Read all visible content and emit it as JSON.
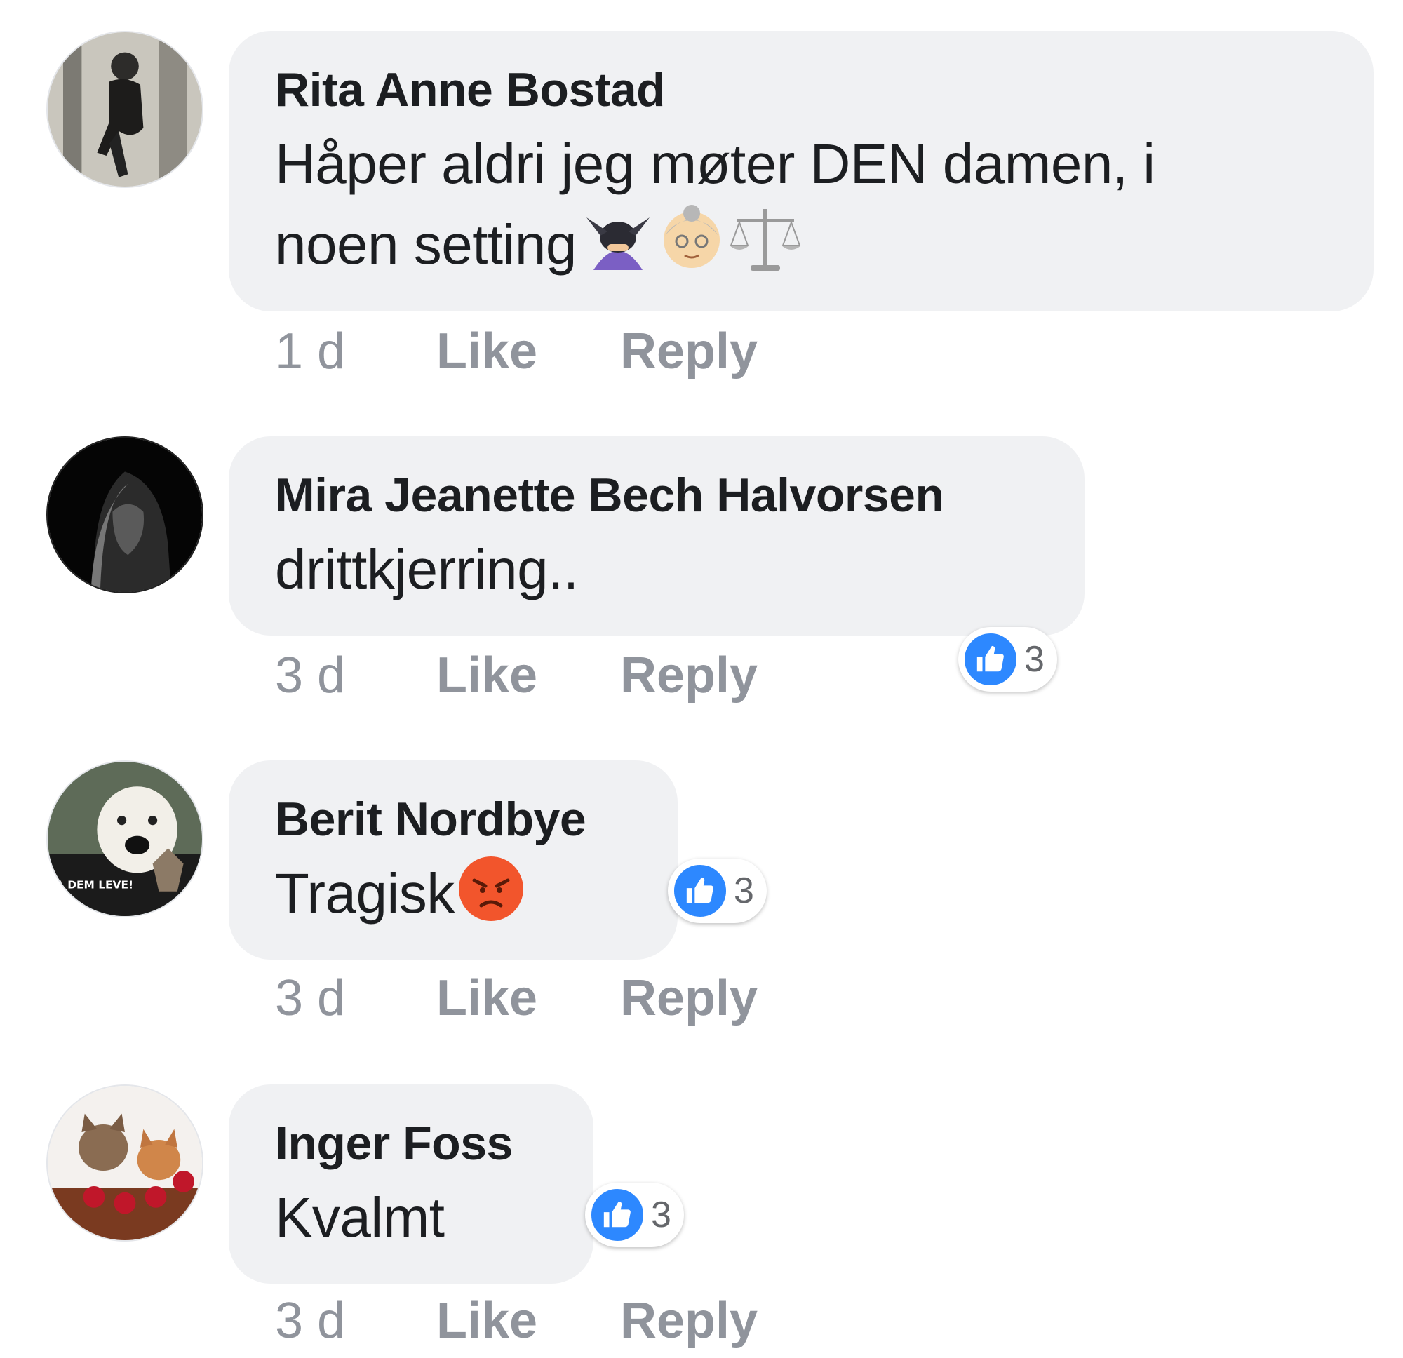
{
  "comments": [
    {
      "author": "Rita Anne Bostad",
      "text_line1": "Håper aldri jeg møter DEN damen, i",
      "text_line2": "noen setting",
      "emojis": [
        "person-bowing-emoji",
        "old-woman-emoji",
        "balance-scale-emoji"
      ],
      "time": "1 d",
      "like_label": "Like",
      "reply_label": "Reply"
    },
    {
      "author": "Mira Jeanette Bech Halvorsen",
      "text": "drittkjerring..",
      "time": "3 d",
      "like_label": "Like",
      "reply_label": "Reply",
      "reaction_count": "3"
    },
    {
      "author": "Berit Nordbye",
      "text": "Tragisk",
      "emojis": [
        "angry-face-emoji"
      ],
      "avatar_text": "LA DEM LEVE!",
      "time": "3 d",
      "like_label": "Like",
      "reply_label": "Reply",
      "reaction_count": "3"
    },
    {
      "author": "Inger Foss",
      "text": "Kvalmt",
      "time": "3 d",
      "like_label": "Like",
      "reply_label": "Reply",
      "reaction_count": "3"
    }
  ],
  "colors": {
    "bubble": "#f0f1f3",
    "action_text": "#90949c",
    "like_blue": "#2d88ff"
  }
}
